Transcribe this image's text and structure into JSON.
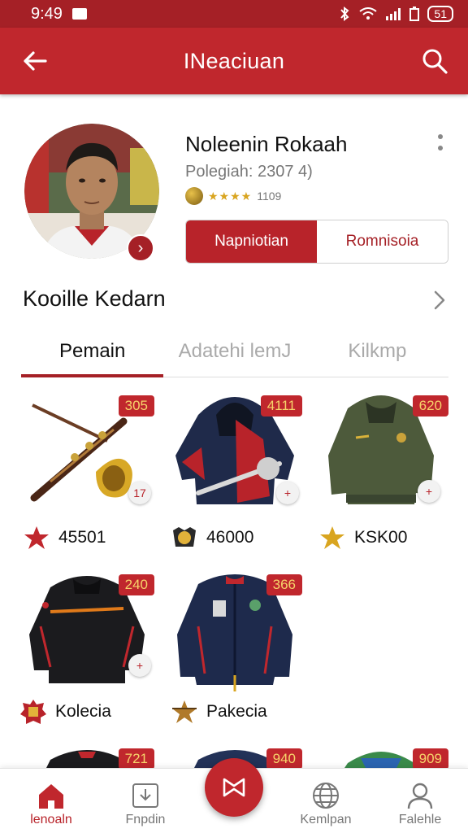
{
  "status_bar": {
    "time": "9:49",
    "battery": "51"
  },
  "app_bar": {
    "title": "INeaciuan"
  },
  "profile": {
    "name": "Noleenin Rokaah",
    "subtitle": "Polegiah: 2307 4)",
    "rating_count": "1109",
    "rating_stars": 4,
    "segment": {
      "active_label": "Napniotian",
      "inactive_label": "Romnisoia"
    }
  },
  "section": {
    "title": "Kooille Kedarn"
  },
  "tabs": [
    {
      "label": "Pemain",
      "active": true
    },
    {
      "label": "Adatehi lemJ",
      "active": false
    },
    {
      "label": "Kilkmp",
      "active": false
    }
  ],
  "items": [
    {
      "price": "305",
      "mini": "17",
      "caption": "45501",
      "thumb": "trumpet",
      "badge": "star"
    },
    {
      "price": "4111",
      "mini": "+",
      "caption": "46000",
      "thumb": "hoodie-jacket",
      "badge": "crest"
    },
    {
      "price": "620",
      "mini": "+",
      "caption": "KSK00",
      "thumb": "olive-jacket",
      "badge": "gold-star"
    },
    {
      "price": "240",
      "mini": "+",
      "caption": "Kolecia",
      "thumb": "track-jacket",
      "badge": "emblem"
    },
    {
      "price": "366",
      "mini": "",
      "caption": "Pakecia",
      "thumb": "navy-jacket",
      "badge": "bronze-star"
    },
    {
      "price": "721",
      "thumb": "black-jacket"
    },
    {
      "price": "940",
      "thumb": "blue-jacket"
    },
    {
      "price": "909",
      "thumb": "green-jacket"
    }
  ],
  "bottom_nav": [
    {
      "label": "lenoaln",
      "icon": "home-icon",
      "active": true
    },
    {
      "label": "Fnpdin",
      "icon": "download-icon",
      "active": false
    },
    {
      "label": "Kemlpan",
      "icon": "globe-icon",
      "active": false
    },
    {
      "label": "Falehle",
      "icon": "profile-icon",
      "active": false
    }
  ],
  "colors": {
    "primary": "#c0272d",
    "primary_dark": "#a52026",
    "price_text": "#f6d36a"
  }
}
